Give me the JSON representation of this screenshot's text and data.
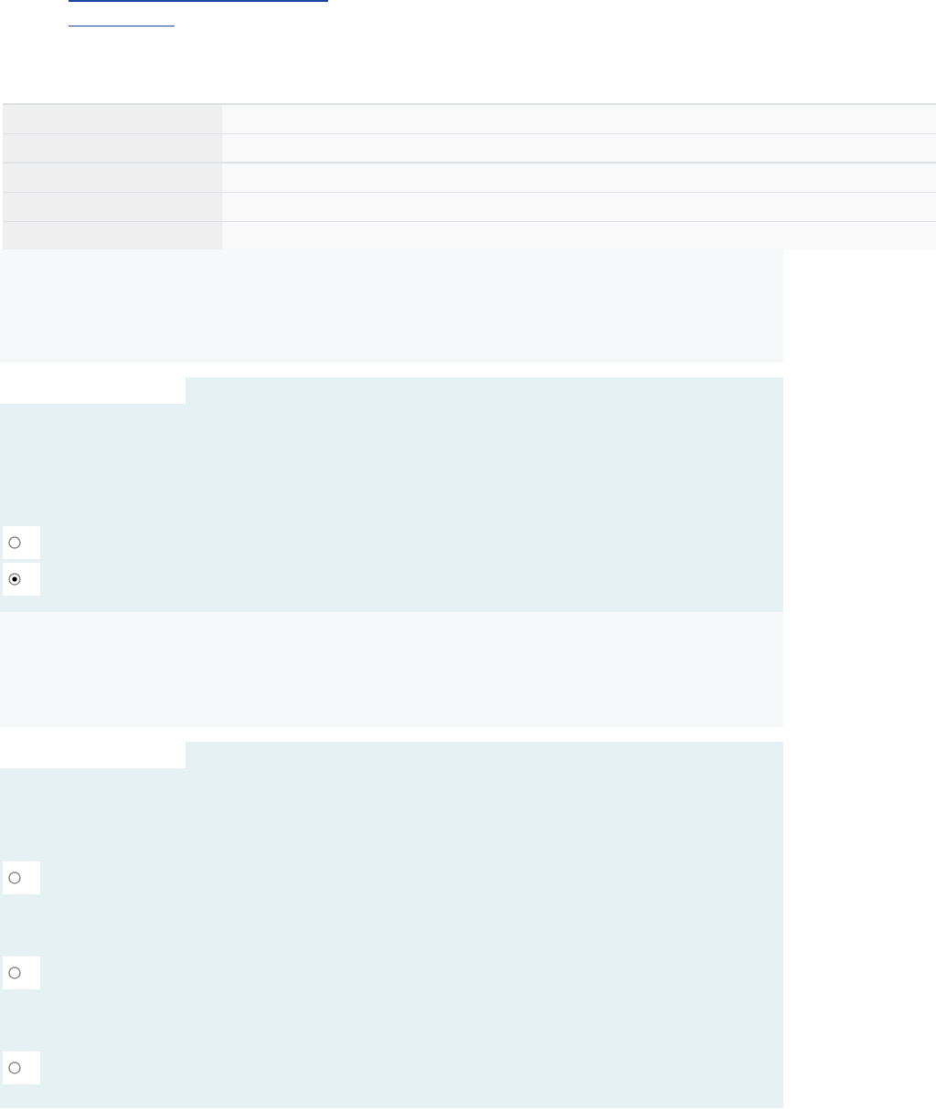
{
  "questions": [
    {
      "options": [
        {
          "selected": false
        },
        {
          "selected": true
        }
      ]
    },
    {
      "options": [
        {
          "selected": false
        },
        {
          "selected": false
        },
        {
          "selected": false
        }
      ]
    }
  ]
}
